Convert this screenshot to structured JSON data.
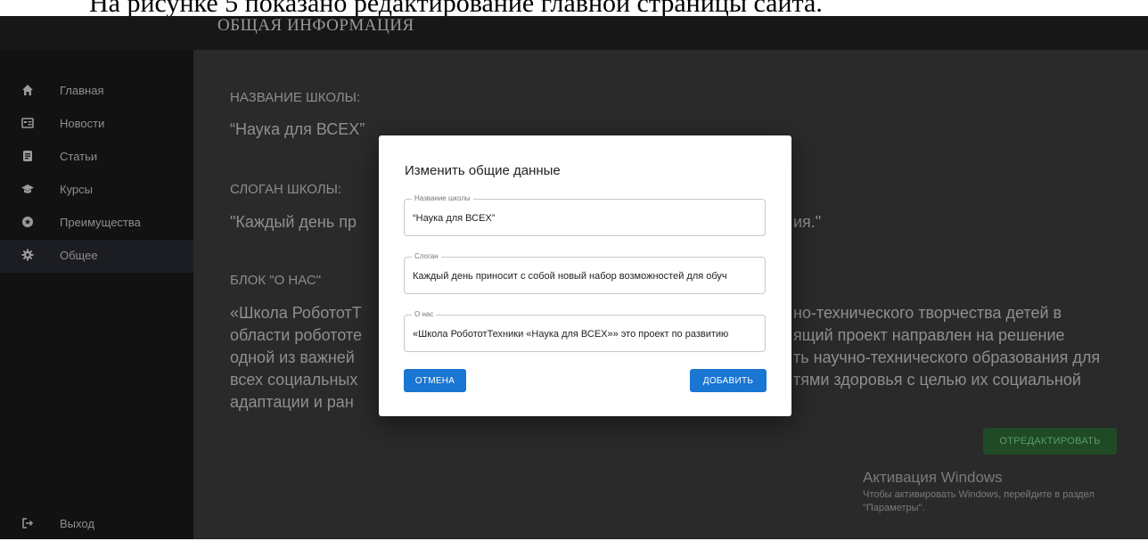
{
  "document": {
    "caption": "На рисунке 5 показано редактирование главной страницы сайта."
  },
  "header": {
    "page_title": "ОБЩАЯ ИНФОРМАЦИЯ"
  },
  "sidebar": {
    "items": [
      {
        "label": "Главная",
        "icon": "home-icon"
      },
      {
        "label": "Новости",
        "icon": "newspaper-icon"
      },
      {
        "label": "Статьи",
        "icon": "article-icon"
      },
      {
        "label": "Курсы",
        "icon": "graduation-cap-icon"
      },
      {
        "label": "Преимущества",
        "icon": "star-circle-icon"
      },
      {
        "label": "Общее",
        "icon": "gear-icon"
      }
    ],
    "active_item": "Общее",
    "logout_label": "Выход",
    "logout_icon": "logout-icon"
  },
  "main": {
    "school_name_label": "НАЗВАНИЕ ШКОЛЫ:",
    "school_name_value": "“Наука для ВСЕХ”",
    "slogan_label": "СЛОГАН ШКОЛЫ:",
    "slogan_value_left": "\"Каждый день пр",
    "slogan_value_right": "ия.\"",
    "about_label": "БЛОК \"О НАС\"",
    "about_left_lines": [
      "«Школа РобототТ",
      "области робототе",
      "одной из важней",
      "всех социальных",
      "адаптации и ран"
    ],
    "about_right_lines": [
      "но-технического творчества детей в",
      "ящий проект направлен на решение",
      "ть научно-технического образования для",
      "тями здоровья с целью их социальной"
    ],
    "edit_button": "ОТРЕДАКТИРОВАТЬ"
  },
  "modal": {
    "title": "Изменить общие данные",
    "fields": [
      {
        "label": "Название школы",
        "value": "“Наука для ВСЕХ”"
      },
      {
        "label": "Слоган",
        "value": "Каждый день приносит с собой новый набор возможностей для обуч"
      },
      {
        "label": "О нас",
        "value": "«Школа РобототТехники «Наука для ВСЕХ»» это проект по развитию"
      }
    ],
    "cancel_button": "ОТМЕНА",
    "add_button": "ДОБАВИТЬ"
  },
  "windows_activation": {
    "title": "Активация Windows",
    "text": "Чтобы активировать Windows, перейдите в раздел \"Параметры\"."
  },
  "colors": {
    "primary": "#1976d2",
    "edit_button_bg": "#1f4a25",
    "content_bg": "#2a2a2a",
    "sidebar_bg": "#121212"
  }
}
